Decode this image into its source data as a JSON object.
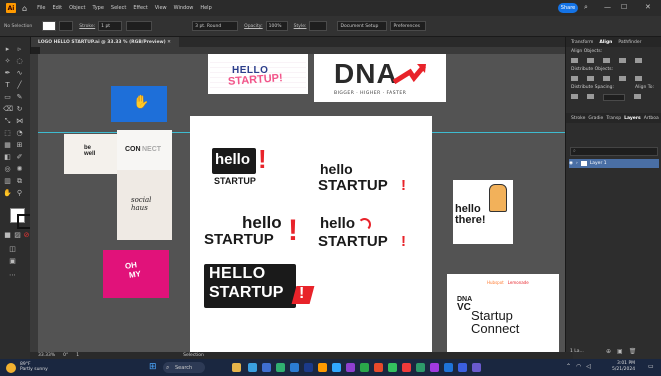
{
  "menubar": {
    "app_logo": "Ai",
    "items": [
      "File",
      "Edit",
      "Object",
      "Type",
      "Select",
      "Effect",
      "View",
      "Window",
      "Help"
    ],
    "share_label": "Share",
    "window_controls": [
      "—",
      "☐",
      "✕"
    ]
  },
  "control_bar": {
    "selection": "No Selection",
    "stroke_label": "Stroke:",
    "stroke_value": "1 pt",
    "brush": "3 pt. Round",
    "opacity_label": "Opacity:",
    "opacity_value": "100%",
    "style_label": "Style:",
    "doc_setup": "Document Setup",
    "preferences": "Preferences"
  },
  "document_tab": {
    "title": "LOGO HELLO STARTUP.ai @ 33.33 % (RGB/Preview)",
    "close": "✕"
  },
  "right_panel": {
    "tabs": [
      "Transform",
      "Align",
      "Pathfinder"
    ],
    "align_objects": "Align Objects:",
    "distribute_objects": "Distribute Objects:",
    "distribute_spacing": "Distribute Spacing:",
    "align_to": "Align To:",
    "layer_tabs": [
      "Stroke",
      "Gradie",
      "Transp",
      "Layers",
      "Artboa"
    ],
    "layer_name": "Layer 1",
    "layers_count": "1 La..."
  },
  "status": {
    "zoom": "33.33%",
    "rotation": "0°",
    "page": "1",
    "mode": "Selection"
  },
  "canvas": {
    "top_logo_1": [
      "HELLO",
      "STARTUP!"
    ],
    "top_logo_2_name": "DNA",
    "top_logo_2_tagline": "BIGGER · HIGHER · FASTER",
    "left_logos": {
      "bewell": [
        "be",
        "well"
      ],
      "connect": [
        "CON",
        "NECT"
      ],
      "social": [
        "social",
        "haus"
      ],
      "ohmy": [
        "OH",
        "MY"
      ]
    },
    "artboard": {
      "logo_a": {
        "hello": "hello",
        "startup": "STARTUP",
        "mark": "!"
      },
      "logo_b": {
        "hello": "hello",
        "startup": "STARTUP",
        "mark": "!"
      },
      "logo_c": {
        "hello": "hello",
        "startup": "STARTUP",
        "mark": "!"
      },
      "logo_d": {
        "hello": "hello",
        "startup": "STARTUP",
        "mark": "!"
      },
      "logo_e": {
        "line1": "HELLO",
        "line2": "STARTUP",
        "mark": "!"
      }
    },
    "hello_there": [
      "hello",
      "there!"
    ],
    "dna_vc": {
      "partners": [
        "Hubspot",
        "Lemonade"
      ],
      "dna": "DNA",
      "vc": "VC",
      "startup": "Startup",
      "connect": "Connect"
    },
    "colors": {
      "accent_red": "#e8232a",
      "hand_blue": "#1e6fd9",
      "ohmy_pink": "#e1127a",
      "guide": "#3ad6f0"
    }
  },
  "taskbar": {
    "weather_temp": "89°F",
    "weather_desc": "Partly sunny",
    "search_placeholder": "Search",
    "time": "3:01 PM",
    "date": "5/21/2024"
  }
}
